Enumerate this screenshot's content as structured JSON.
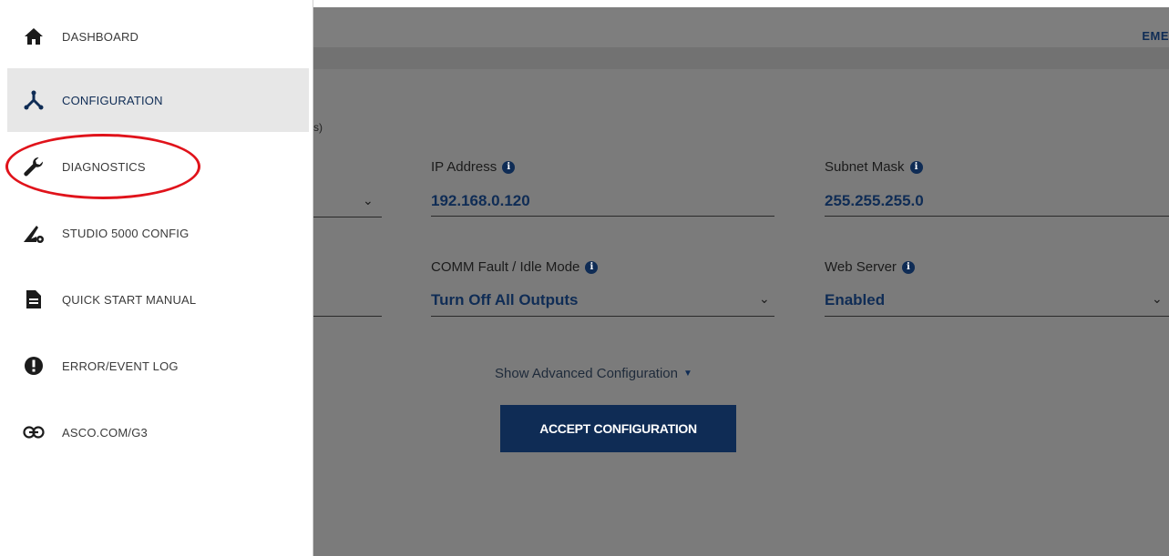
{
  "header": {
    "brand_fragment": "EME"
  },
  "section_fragment": "s)",
  "fields": {
    "ip_address": {
      "label": "IP Address",
      "value": "192.168.0.120"
    },
    "subnet_mask": {
      "label": "Subnet Mask",
      "value": "255.255.255.0"
    },
    "comm_fault": {
      "label": "COMM Fault / Idle Mode",
      "value": "Turn Off All Outputs"
    },
    "web_server": {
      "label": "Web Server",
      "value": "Enabled"
    }
  },
  "advanced_toggle": "Show Advanced Configuration",
  "accept_button": "ACCEPT CONFIGURATION",
  "nav": [
    {
      "label": "DASHBOARD",
      "icon": "home-icon"
    },
    {
      "label": "CONFIGURATION",
      "icon": "network-icon",
      "active": true
    },
    {
      "label": "DIAGNOSTICS",
      "icon": "wrench-icon"
    },
    {
      "label": "STUDIO 5000 CONFIG",
      "icon": "studio-config-icon"
    },
    {
      "label": "QUICK START MANUAL",
      "icon": "document-icon"
    },
    {
      "label": "ERROR/EVENT LOG",
      "icon": "alert-icon"
    },
    {
      "label": "ASCO.COM/G3",
      "icon": "link-icon"
    }
  ],
  "colors": {
    "accent": "#0f2c55",
    "highlight": "#e0131b",
    "overlay": "#7b7b7b"
  }
}
